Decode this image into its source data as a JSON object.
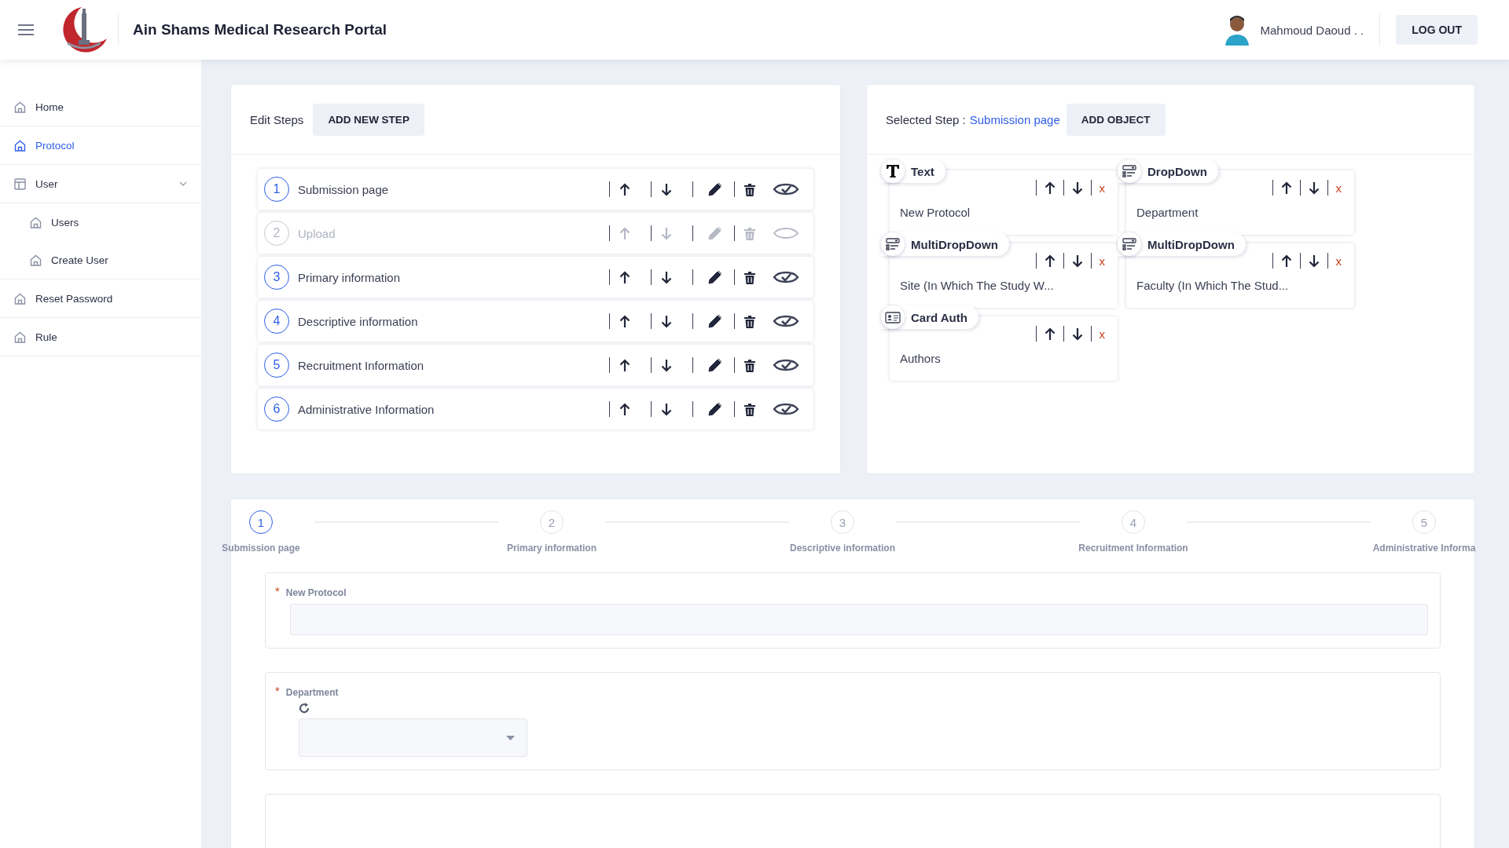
{
  "header": {
    "title": "Ain Shams Medical Research Portal",
    "user_name": "Mahmoud Daoud . .",
    "logout": "LOG OUT"
  },
  "sidebar": {
    "items": [
      {
        "label": "Home",
        "selected": false
      },
      {
        "label": "Protocol",
        "selected": true
      },
      {
        "label": "User",
        "selected": false,
        "expanded": true,
        "children": [
          {
            "label": "Users",
            "selected": false
          },
          {
            "label": "Create User",
            "selected": false
          }
        ]
      },
      {
        "label": "Reset Password",
        "selected": false
      },
      {
        "label": "Rule",
        "selected": false
      }
    ]
  },
  "steps_panel": {
    "title": "Edit Steps",
    "add_button": "ADD NEW STEP",
    "steps": [
      {
        "number": "1",
        "name": "Submission page",
        "visible": true
      },
      {
        "number": "2",
        "name": "Upload",
        "visible": false
      },
      {
        "number": "3",
        "name": "Primary information",
        "visible": true
      },
      {
        "number": "4",
        "name": "Descriptive information",
        "visible": true
      },
      {
        "number": "5",
        "name": "Recruitment Information",
        "visible": true
      },
      {
        "number": "6",
        "name": "Administrative Information",
        "visible": true
      }
    ]
  },
  "objects_panel": {
    "label": "Selected Step :",
    "selected_step": "Submission page",
    "add_button": "ADD OBJECT",
    "objects": [
      {
        "kind": "text",
        "type": "Text",
        "value": "New Protocol",
        "remove": "x"
      },
      {
        "kind": "dropdown",
        "type": "DropDown",
        "value": "Department",
        "remove": "x"
      },
      {
        "kind": "dropdown",
        "type": "MultiDropDown",
        "value": "Site (In Which The Study W...",
        "remove": "x"
      },
      {
        "kind": "dropdown",
        "type": "MultiDropDown",
        "value": "Faculty (In Which The Stud...",
        "remove": "x"
      },
      {
        "kind": "card",
        "type": "Card Auth",
        "value": "Authors",
        "remove": "x"
      }
    ]
  },
  "stepper": {
    "steps": [
      {
        "number": "1",
        "label": "Submission page",
        "selected": true
      },
      {
        "number": "2",
        "label": "Primary information",
        "selected": false
      },
      {
        "number": "3",
        "label": "Descriptive information",
        "selected": false
      },
      {
        "number": "4",
        "label": "Recruitment Information",
        "selected": false
      },
      {
        "number": "5",
        "label": "Administrative Informa",
        "selected": false
      }
    ]
  },
  "form": {
    "fields": [
      {
        "kind": "text",
        "marker": "*",
        "label": "New Protocol"
      },
      {
        "kind": "dropdown",
        "marker": "*",
        "label": "Department"
      }
    ]
  }
}
